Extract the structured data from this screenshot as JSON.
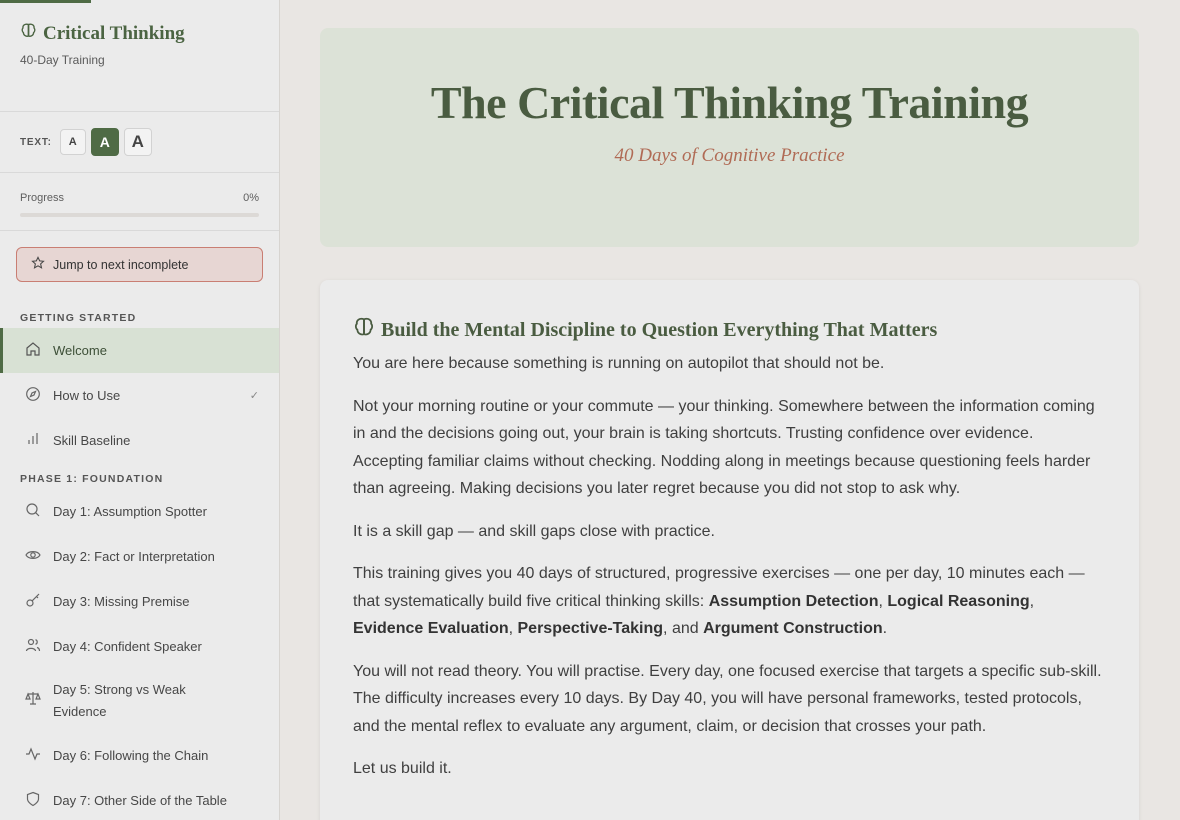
{
  "sidebar": {
    "brand_title": "Critical Thinking",
    "brand_subtitle": "40-Day Training",
    "text_size": {
      "label": "TEXT:",
      "small": "A",
      "medium": "A",
      "large": "A"
    },
    "progress": {
      "label": "Progress",
      "value_text": "0%",
      "value": 0
    },
    "jump_label": "Jump to next incomplete",
    "sections": [
      {
        "label": "GETTING STARTED",
        "items": [
          {
            "label": "Welcome",
            "icon": "home-icon",
            "active": true
          },
          {
            "label": "How to Use",
            "icon": "compass-icon",
            "completed_mark": "✓"
          },
          {
            "label": "Skill Baseline",
            "icon": "bar-chart-icon"
          }
        ]
      },
      {
        "label": "PHASE 1: FOUNDATION",
        "items": [
          {
            "label": "Day 1: Assumption Spotter",
            "icon": "search-icon"
          },
          {
            "label": "Day 2: Fact or Interpretation",
            "icon": "eye-icon"
          },
          {
            "label": "Day 3: Missing Premise",
            "icon": "key-icon"
          },
          {
            "label": "Day 4: Confident Speaker",
            "icon": "users-icon"
          },
          {
            "label": "Day 5: Strong vs Weak Evidence",
            "icon": "scale-icon"
          },
          {
            "label": "Day 6: Following the Chain",
            "icon": "activity-icon"
          },
          {
            "label": "Day 7: Other Side of the Table",
            "icon": "shield-icon"
          }
        ]
      }
    ]
  },
  "hero": {
    "title": "The Critical Thinking Training",
    "subtitle": "40 Days of Cognitive Practice"
  },
  "intro": {
    "heading": "Build the Mental Discipline to Question Everything That Matters",
    "p1": "You are here because something is running on autopilot that should not be.",
    "p2": "Not your morning routine or your commute — your thinking. Somewhere between the information coming in and the decisions going out, your brain is taking shortcuts. Trusting confidence over evidence. Accepting familiar claims without checking. Nodding along in meetings because questioning feels harder than agreeing. Making decisions you later regret because you did not stop to ask why.",
    "p3": "It is a skill gap — and skill gaps close with practice.",
    "p4_intro": "This training gives you 40 days of structured, progressive exercises — one per day, 10 minutes each — that systematically build five critical thinking skills: ",
    "skills": [
      "Assumption Detection",
      "Logical Reasoning",
      "Evidence Evaluation",
      "Perspective-Taking",
      "Argument Construction"
    ],
    "sep_comma": ", ",
    "sep_and": ", and ",
    "period": ".",
    "p5": "You will not read theory. You will practise. Every day, one focused exercise that targets a specific sub-skill. The difficulty increases every 10 days. By Day 40, you will have personal frameworks, tested protocols, and the mental reflex to evaluate any argument, claim, or decision that crosses your path.",
    "p6": "Let us build it."
  },
  "colors": {
    "accent": "#4f6b45",
    "hero_bg": "#dce2d7",
    "subtitle": "#b06b55",
    "jump_border": "#c97e73"
  }
}
